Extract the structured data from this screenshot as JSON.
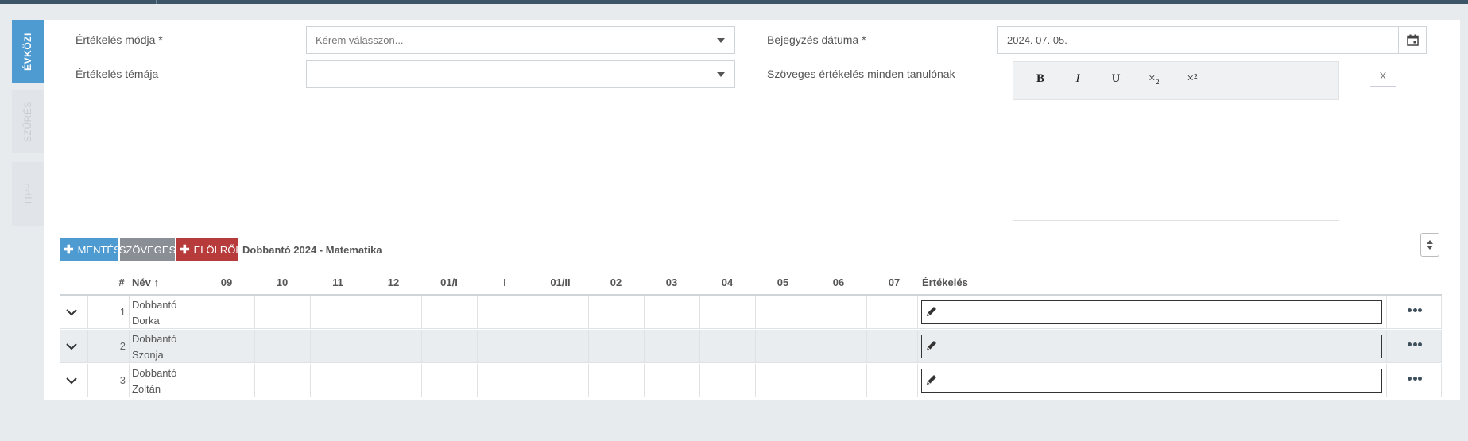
{
  "side_tabs": [
    {
      "label": "ÉVKÖZI",
      "active": true
    },
    {
      "label": "SZŰRÉS",
      "active": false
    },
    {
      "label": "TIPP",
      "active": false
    }
  ],
  "form": {
    "mode_label": "Értékelés módja *",
    "mode_placeholder": "Kérem válasszon...",
    "topic_label": "Értékelés témája",
    "topic_value": "",
    "date_label": "Bejegyzés dátuma *",
    "date_value": "2024. 07. 05.",
    "text_eval_label": "Szöveges értékelés minden tanulónak",
    "editor_buttons": [
      "B",
      "I",
      "U",
      "×₂",
      "×²"
    ],
    "clear_button": "X"
  },
  "toolbar": {
    "save_label": "MENTÉS",
    "text_label": "SZÖVEGES",
    "reset_label": "ELÖLRŐL",
    "subject": "Dobbantó 2024 - Matematika"
  },
  "table": {
    "headers": {
      "hash": "#",
      "name": "Név",
      "months": [
        "09",
        "10",
        "11",
        "12",
        "01/I",
        "I",
        "01/II",
        "02",
        "03",
        "04",
        "05",
        "06",
        "07"
      ],
      "grade": "Értékelés"
    },
    "rows": [
      {
        "num": "1",
        "name_line1": "Dobbantó",
        "name_line2": "Dorka"
      },
      {
        "num": "2",
        "name_line1": "Dobbantó",
        "name_line2": "Szonja"
      },
      {
        "num": "3",
        "name_line1": "Dobbantó",
        "name_line2": "Zoltán"
      }
    ]
  },
  "colors": {
    "primary": "#4e9bd1",
    "gray": "#8a8f96",
    "danger": "#b73b3b",
    "topbar": "#3c5667"
  }
}
